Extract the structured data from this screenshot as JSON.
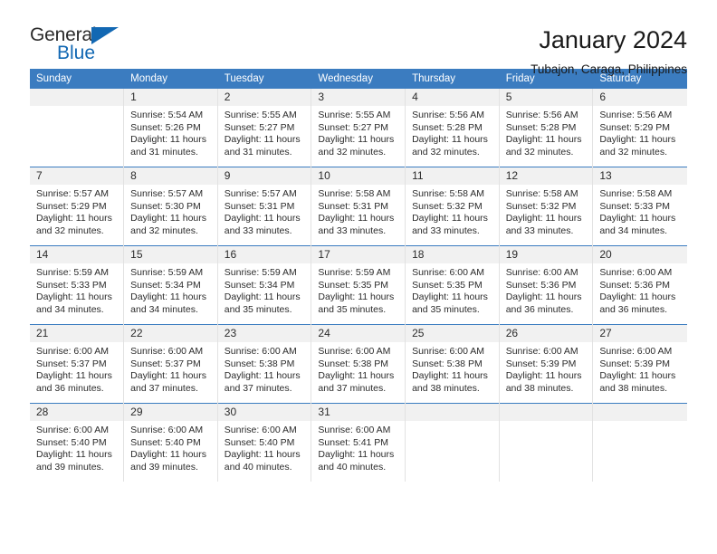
{
  "brand": {
    "name_part1": "General",
    "name_part2": "Blue",
    "accent_color": "#1268b3"
  },
  "header": {
    "title": "January 2024",
    "subtitle": "Tubajon, Caraga, Philippines"
  },
  "theme": {
    "header_bg": "#3b7cc0",
    "daynum_bg": "#f1f1f1",
    "text": "#2b2b2b"
  },
  "calendar": {
    "weekday_headers": [
      "Sunday",
      "Monday",
      "Tuesday",
      "Wednesday",
      "Thursday",
      "Friday",
      "Saturday"
    ],
    "weeks": [
      [
        {
          "day": "",
          "sunrise": "",
          "sunset": "",
          "daylight_line1": "",
          "daylight_line2": ""
        },
        {
          "day": "1",
          "sunrise": "Sunrise: 5:54 AM",
          "sunset": "Sunset: 5:26 PM",
          "daylight_line1": "Daylight: 11 hours",
          "daylight_line2": "and 31 minutes."
        },
        {
          "day": "2",
          "sunrise": "Sunrise: 5:55 AM",
          "sunset": "Sunset: 5:27 PM",
          "daylight_line1": "Daylight: 11 hours",
          "daylight_line2": "and 31 minutes."
        },
        {
          "day": "3",
          "sunrise": "Sunrise: 5:55 AM",
          "sunset": "Sunset: 5:27 PM",
          "daylight_line1": "Daylight: 11 hours",
          "daylight_line2": "and 32 minutes."
        },
        {
          "day": "4",
          "sunrise": "Sunrise: 5:56 AM",
          "sunset": "Sunset: 5:28 PM",
          "daylight_line1": "Daylight: 11 hours",
          "daylight_line2": "and 32 minutes."
        },
        {
          "day": "5",
          "sunrise": "Sunrise: 5:56 AM",
          "sunset": "Sunset: 5:28 PM",
          "daylight_line1": "Daylight: 11 hours",
          "daylight_line2": "and 32 minutes."
        },
        {
          "day": "6",
          "sunrise": "Sunrise: 5:56 AM",
          "sunset": "Sunset: 5:29 PM",
          "daylight_line1": "Daylight: 11 hours",
          "daylight_line2": "and 32 minutes."
        }
      ],
      [
        {
          "day": "7",
          "sunrise": "Sunrise: 5:57 AM",
          "sunset": "Sunset: 5:29 PM",
          "daylight_line1": "Daylight: 11 hours",
          "daylight_line2": "and 32 minutes."
        },
        {
          "day": "8",
          "sunrise": "Sunrise: 5:57 AM",
          "sunset": "Sunset: 5:30 PM",
          "daylight_line1": "Daylight: 11 hours",
          "daylight_line2": "and 32 minutes."
        },
        {
          "day": "9",
          "sunrise": "Sunrise: 5:57 AM",
          "sunset": "Sunset: 5:31 PM",
          "daylight_line1": "Daylight: 11 hours",
          "daylight_line2": "and 33 minutes."
        },
        {
          "day": "10",
          "sunrise": "Sunrise: 5:58 AM",
          "sunset": "Sunset: 5:31 PM",
          "daylight_line1": "Daylight: 11 hours",
          "daylight_line2": "and 33 minutes."
        },
        {
          "day": "11",
          "sunrise": "Sunrise: 5:58 AM",
          "sunset": "Sunset: 5:32 PM",
          "daylight_line1": "Daylight: 11 hours",
          "daylight_line2": "and 33 minutes."
        },
        {
          "day": "12",
          "sunrise": "Sunrise: 5:58 AM",
          "sunset": "Sunset: 5:32 PM",
          "daylight_line1": "Daylight: 11 hours",
          "daylight_line2": "and 33 minutes."
        },
        {
          "day": "13",
          "sunrise": "Sunrise: 5:58 AM",
          "sunset": "Sunset: 5:33 PM",
          "daylight_line1": "Daylight: 11 hours",
          "daylight_line2": "and 34 minutes."
        }
      ],
      [
        {
          "day": "14",
          "sunrise": "Sunrise: 5:59 AM",
          "sunset": "Sunset: 5:33 PM",
          "daylight_line1": "Daylight: 11 hours",
          "daylight_line2": "and 34 minutes."
        },
        {
          "day": "15",
          "sunrise": "Sunrise: 5:59 AM",
          "sunset": "Sunset: 5:34 PM",
          "daylight_line1": "Daylight: 11 hours",
          "daylight_line2": "and 34 minutes."
        },
        {
          "day": "16",
          "sunrise": "Sunrise: 5:59 AM",
          "sunset": "Sunset: 5:34 PM",
          "daylight_line1": "Daylight: 11 hours",
          "daylight_line2": "and 35 minutes."
        },
        {
          "day": "17",
          "sunrise": "Sunrise: 5:59 AM",
          "sunset": "Sunset: 5:35 PM",
          "daylight_line1": "Daylight: 11 hours",
          "daylight_line2": "and 35 minutes."
        },
        {
          "day": "18",
          "sunrise": "Sunrise: 6:00 AM",
          "sunset": "Sunset: 5:35 PM",
          "daylight_line1": "Daylight: 11 hours",
          "daylight_line2": "and 35 minutes."
        },
        {
          "day": "19",
          "sunrise": "Sunrise: 6:00 AM",
          "sunset": "Sunset: 5:36 PM",
          "daylight_line1": "Daylight: 11 hours",
          "daylight_line2": "and 36 minutes."
        },
        {
          "day": "20",
          "sunrise": "Sunrise: 6:00 AM",
          "sunset": "Sunset: 5:36 PM",
          "daylight_line1": "Daylight: 11 hours",
          "daylight_line2": "and 36 minutes."
        }
      ],
      [
        {
          "day": "21",
          "sunrise": "Sunrise: 6:00 AM",
          "sunset": "Sunset: 5:37 PM",
          "daylight_line1": "Daylight: 11 hours",
          "daylight_line2": "and 36 minutes."
        },
        {
          "day": "22",
          "sunrise": "Sunrise: 6:00 AM",
          "sunset": "Sunset: 5:37 PM",
          "daylight_line1": "Daylight: 11 hours",
          "daylight_line2": "and 37 minutes."
        },
        {
          "day": "23",
          "sunrise": "Sunrise: 6:00 AM",
          "sunset": "Sunset: 5:38 PM",
          "daylight_line1": "Daylight: 11 hours",
          "daylight_line2": "and 37 minutes."
        },
        {
          "day": "24",
          "sunrise": "Sunrise: 6:00 AM",
          "sunset": "Sunset: 5:38 PM",
          "daylight_line1": "Daylight: 11 hours",
          "daylight_line2": "and 37 minutes."
        },
        {
          "day": "25",
          "sunrise": "Sunrise: 6:00 AM",
          "sunset": "Sunset: 5:38 PM",
          "daylight_line1": "Daylight: 11 hours",
          "daylight_line2": "and 38 minutes."
        },
        {
          "day": "26",
          "sunrise": "Sunrise: 6:00 AM",
          "sunset": "Sunset: 5:39 PM",
          "daylight_line1": "Daylight: 11 hours",
          "daylight_line2": "and 38 minutes."
        },
        {
          "day": "27",
          "sunrise": "Sunrise: 6:00 AM",
          "sunset": "Sunset: 5:39 PM",
          "daylight_line1": "Daylight: 11 hours",
          "daylight_line2": "and 38 minutes."
        }
      ],
      [
        {
          "day": "28",
          "sunrise": "Sunrise: 6:00 AM",
          "sunset": "Sunset: 5:40 PM",
          "daylight_line1": "Daylight: 11 hours",
          "daylight_line2": "and 39 minutes."
        },
        {
          "day": "29",
          "sunrise": "Sunrise: 6:00 AM",
          "sunset": "Sunset: 5:40 PM",
          "daylight_line1": "Daylight: 11 hours",
          "daylight_line2": "and 39 minutes."
        },
        {
          "day": "30",
          "sunrise": "Sunrise: 6:00 AM",
          "sunset": "Sunset: 5:40 PM",
          "daylight_line1": "Daylight: 11 hours",
          "daylight_line2": "and 40 minutes."
        },
        {
          "day": "31",
          "sunrise": "Sunrise: 6:00 AM",
          "sunset": "Sunset: 5:41 PM",
          "daylight_line1": "Daylight: 11 hours",
          "daylight_line2": "and 40 minutes."
        },
        {
          "day": "",
          "sunrise": "",
          "sunset": "",
          "daylight_line1": "",
          "daylight_line2": ""
        },
        {
          "day": "",
          "sunrise": "",
          "sunset": "",
          "daylight_line1": "",
          "daylight_line2": ""
        },
        {
          "day": "",
          "sunrise": "",
          "sunset": "",
          "daylight_line1": "",
          "daylight_line2": ""
        }
      ]
    ]
  }
}
